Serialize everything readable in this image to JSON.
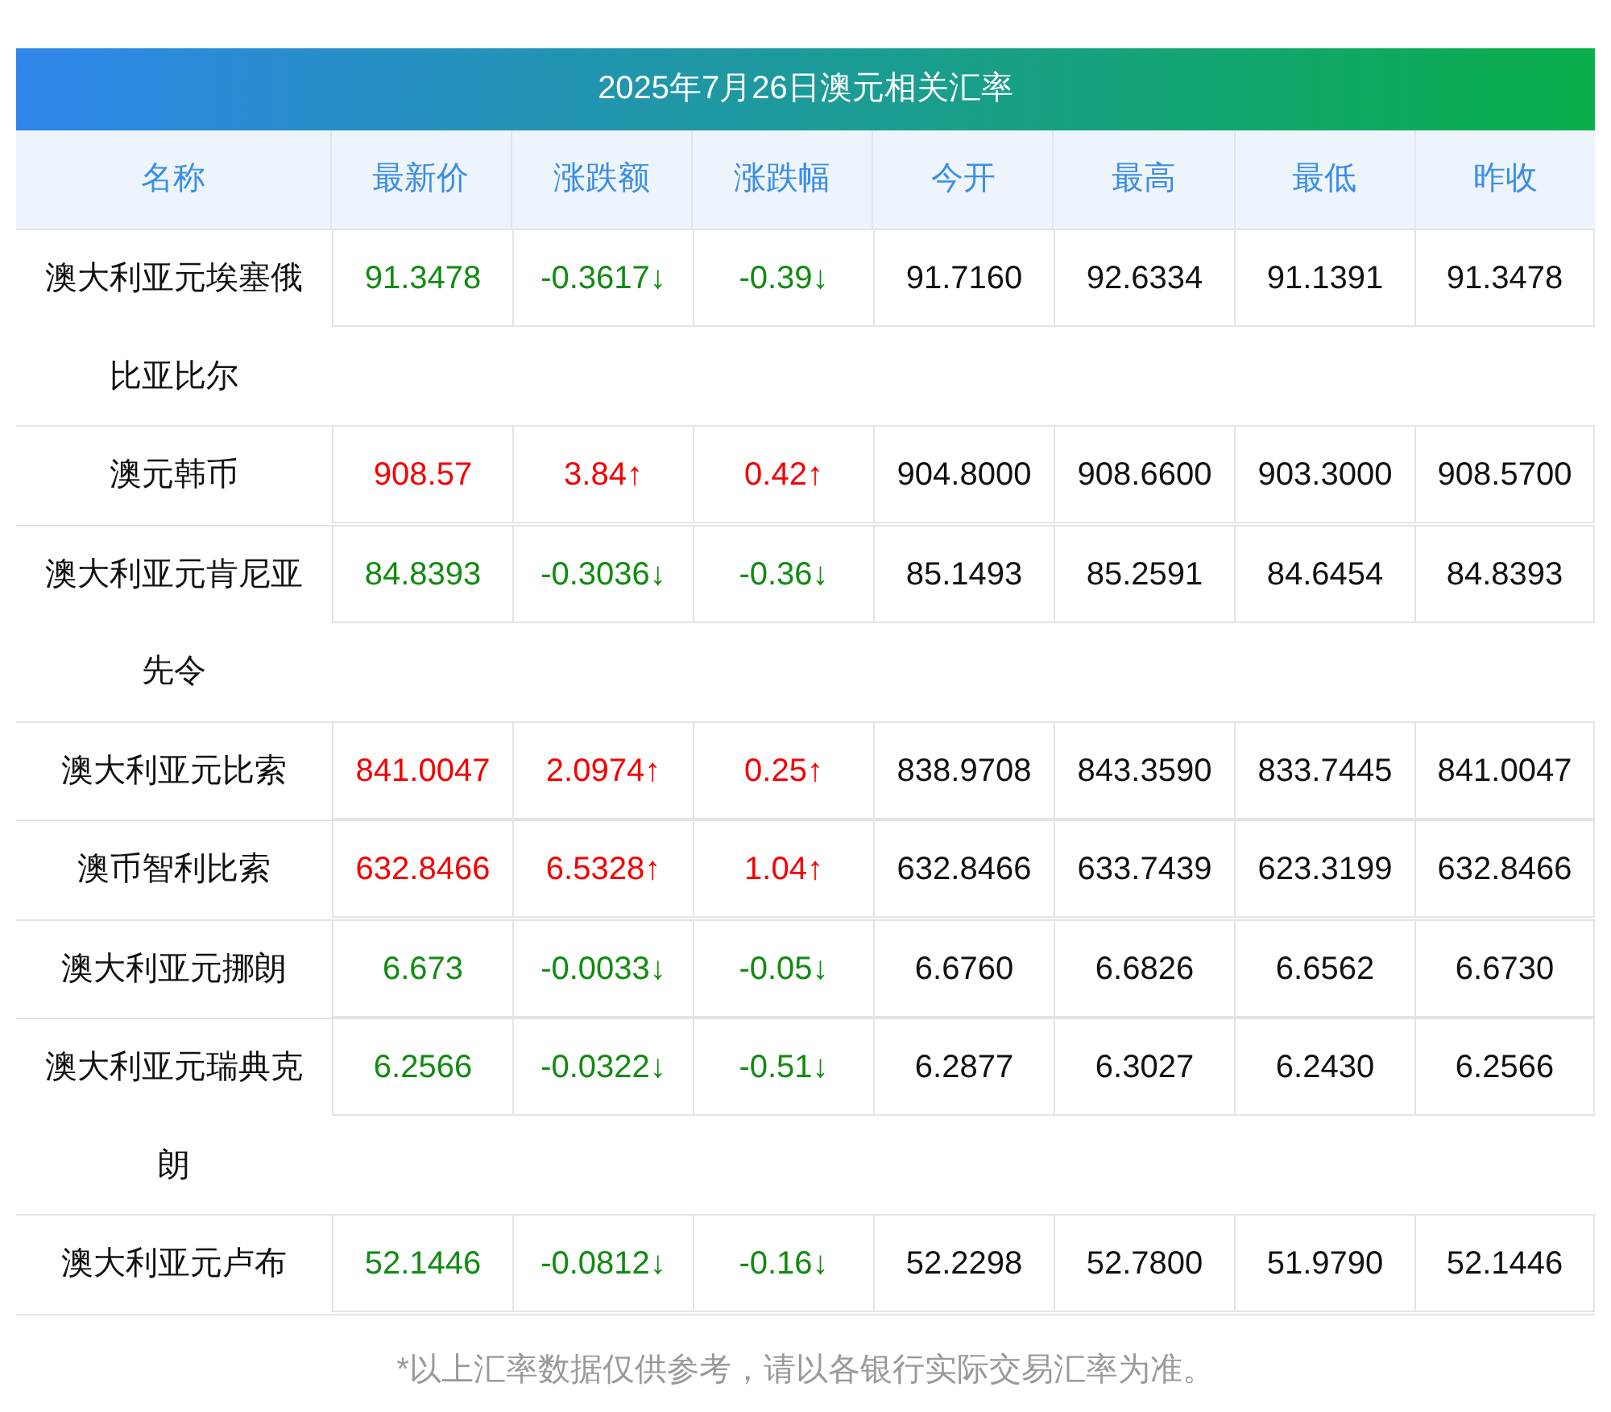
{
  "title": "2025年7月26日澳元相关汇率",
  "columns": [
    "名称",
    "最新价",
    "涨跌额",
    "涨跌幅",
    "今开",
    "最高",
    "最低",
    "昨收"
  ],
  "rows": [
    {
      "color": "#118b11",
      "cells": [
        "澳大利亚元埃塞俄比亚比尔",
        "91.3478",
        "-0.3617↓",
        "-0.39↓",
        "91.7160",
        "92.6334",
        "91.1391",
        "91.3478"
      ]
    },
    {
      "color": "#f40000",
      "cells": [
        "澳元韩币",
        "908.57",
        "3.84↑",
        "0.42↑",
        "904.8000",
        "908.6600",
        "903.3000",
        "908.5700"
      ]
    },
    {
      "color": "#118b11",
      "cells": [
        "澳大利亚元肯尼亚先令",
        "84.8393",
        "-0.3036↓",
        "-0.36↓",
        "85.1493",
        "85.2591",
        "84.6454",
        "84.8393"
      ]
    },
    {
      "color": "#f40000",
      "cells": [
        "澳大利亚元比索",
        "841.0047",
        "2.0974↑",
        "0.25↑",
        "838.9708",
        "843.3590",
        "833.7445",
        "841.0047"
      ]
    },
    {
      "color": "#f40000",
      "cells": [
        "澳币智利比索",
        "632.8466",
        "6.5328↑",
        "1.04↑",
        "632.8466",
        "633.7439",
        "623.3199",
        "632.8466"
      ]
    },
    {
      "color": "#118b11",
      "cells": [
        "澳大利亚元挪朗",
        "6.673",
        "-0.0033↓",
        "-0.05↓",
        "6.6760",
        "6.6826",
        "6.6562",
        "6.6730"
      ]
    },
    {
      "color": "#118b11",
      "cells": [
        "澳大利亚元瑞典克朗",
        "6.2566",
        "-0.0322↓",
        "-0.51↓",
        "6.2877",
        "6.3027",
        "6.2430",
        "6.2566"
      ]
    },
    {
      "color": "#118b11",
      "cells": [
        "澳大利亚元卢布",
        "52.1446",
        "-0.0812↓",
        "-0.16↓",
        "52.2298",
        "52.7800",
        "51.9790",
        "52.1446"
      ]
    }
  ],
  "note": "*以上汇率数据仅供参考，请以各银行实际交易汇率为准。"
}
